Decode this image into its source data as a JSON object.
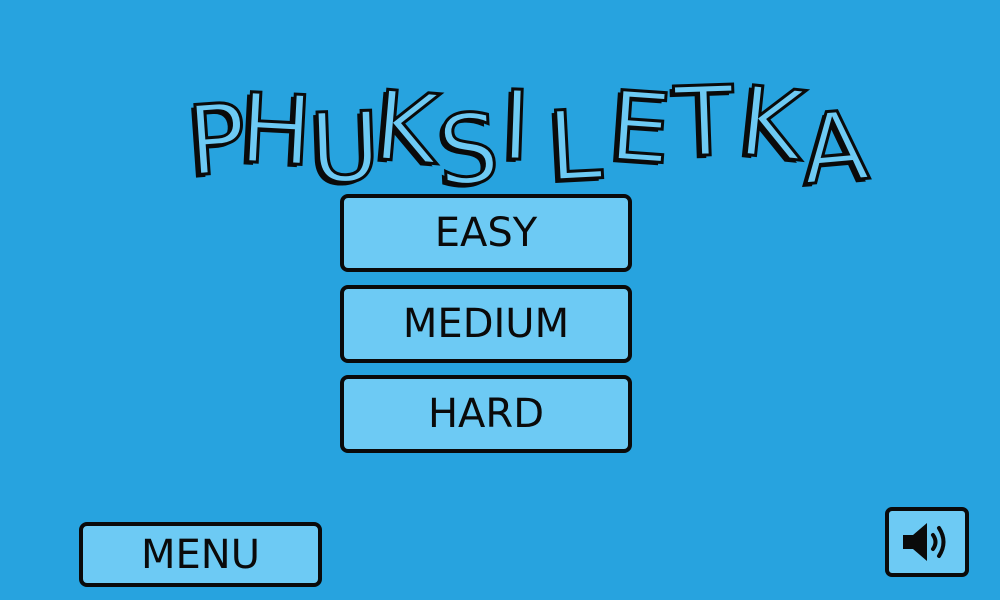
{
  "title": {
    "text": "PHUKSILETKA",
    "letters": [
      "P",
      "H",
      "U",
      "K",
      "S",
      "I",
      "L",
      "E",
      "T",
      "K",
      "A"
    ]
  },
  "difficulty": {
    "easy_label": "EASY",
    "medium_label": "MEDIUM",
    "hard_label": "HARD"
  },
  "footer": {
    "menu_label": "MENU",
    "sound_icon": "speaker-on-icon"
  },
  "colors": {
    "background": "#27a3df",
    "button_fill": "#6dcaf4",
    "outline": "#0a0a0a"
  }
}
